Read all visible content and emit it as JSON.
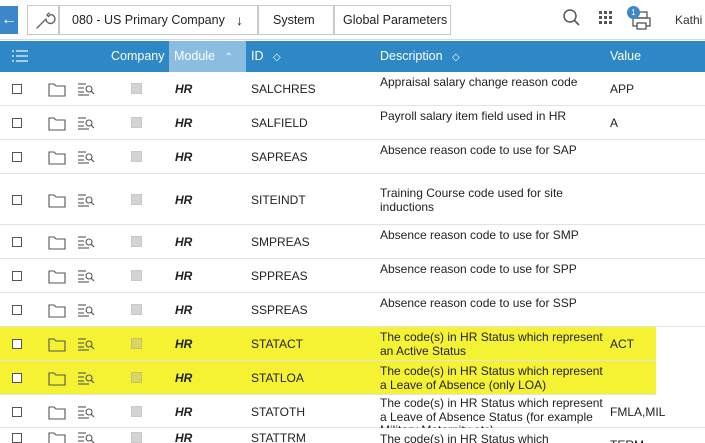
{
  "toolbar": {
    "company": "080 - US Primary Company",
    "system": "System",
    "global_parameters": "Global Parameters",
    "notification_count": "1",
    "user": "Kathi"
  },
  "table": {
    "headers": {
      "company": "Company",
      "module": "Module",
      "id": "ID",
      "description": "Description",
      "value": "Value"
    },
    "rows": [
      {
        "module": "HR",
        "id": "SALCHRES",
        "description": "Appraisal salary change reason code",
        "value": "APP",
        "highlight": false
      },
      {
        "module": "HR",
        "id": "SALFIELD",
        "description": "Payroll salary item field used in HR",
        "value": "A",
        "highlight": false
      },
      {
        "module": "HR",
        "id": "SAPREAS",
        "description": "Absence reason code to use for SAP",
        "value": "",
        "highlight": false
      },
      {
        "module": "HR",
        "id": "SITEINDT",
        "description": "Training Course code used for site inductions",
        "value": "",
        "highlight": false
      },
      {
        "module": "HR",
        "id": "SMPREAS",
        "description": "Absence reason code to use for SMP",
        "value": "",
        "highlight": false
      },
      {
        "module": "HR",
        "id": "SPPREAS",
        "description": "Absence reason code to use for SPP",
        "value": "",
        "highlight": false
      },
      {
        "module": "HR",
        "id": "SSPREAS",
        "description": "Absence reason code to use for SSP",
        "value": "",
        "highlight": false
      },
      {
        "module": "HR",
        "id": "STATACT",
        "description": "The code(s) in HR Status which represent an Active Status",
        "value": "ACT",
        "highlight": true
      },
      {
        "module": "HR",
        "id": "STATLOA",
        "description": "The code(s) in HR Status which represent a Leave of Absence (only LOA)",
        "value": "",
        "highlight": true
      },
      {
        "module": "HR",
        "id": "STATOTH",
        "description": "The code(s) in HR Status which represent a Leave of Absence Status (for example Military Maternity etc)",
        "value": "FMLA,MIL",
        "highlight": false
      },
      {
        "module": "HR",
        "id": "STATTRM",
        "description": "The code(s) in HR Status which",
        "value": "TERM",
        "highlight": false
      }
    ]
  },
  "colors": {
    "header_bg": "#2e88c5",
    "highlight": "#f5f233"
  }
}
